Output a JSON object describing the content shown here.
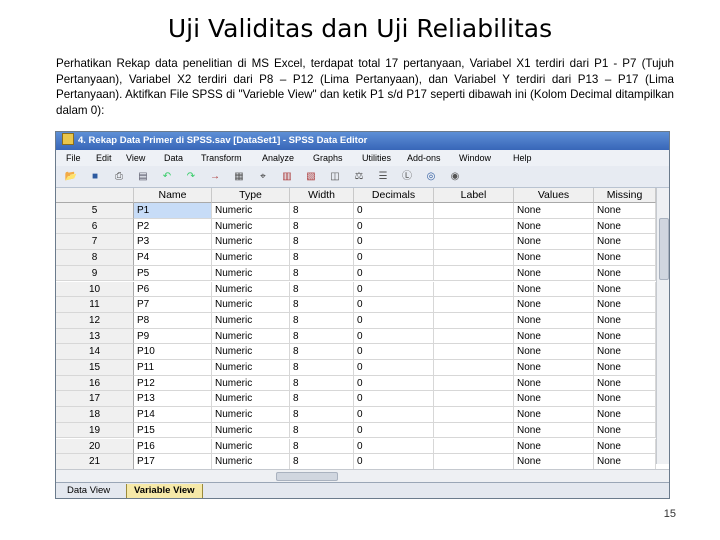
{
  "slide": {
    "title": "Uji Validitas dan Uji Reliabilitas",
    "intro": "Perhatikan Rekap data penelitian di MS Excel, terdapat total 17 pertanyaan, Variabel X1 terdiri dari P1 - P7 (Tujuh Pertanyaan), Variabel X2 terdiri dari P8 – P12 (Lima Pertanyaan), dan Variabel Y terdiri dari P13 – P17 (Lima Pertanyaan). Aktifkan File SPSS di \"Varieble View\" dan ketik P1 s/d P17 seperti dibawah ini (Kolom Decimal ditampilkan dalam 0):",
    "page_number": "15"
  },
  "window": {
    "title": "4. Rekap Data Primer di SPSS.sav [DataSet1] - SPSS Data Editor"
  },
  "menu": [
    "File",
    "Edit",
    "View",
    "Data",
    "Transform",
    "Analyze",
    "Graphs",
    "Utilities",
    "Add-ons",
    "Window",
    "Help"
  ],
  "toolbar_icons": [
    "open-icon",
    "save-icon",
    "print-icon",
    "dialog-recall-icon",
    "undo-icon",
    "redo-icon",
    "goto-case-icon",
    "variables-icon",
    "find-icon",
    "insert-cases-icon",
    "insert-variable-icon",
    "split-file-icon",
    "weight-cases-icon",
    "select-cases-icon",
    "value-labels-icon",
    "use-sets-icon",
    "show-all-icon"
  ],
  "columns": [
    "Name",
    "Type",
    "Width",
    "Decimals",
    "Label",
    "Values",
    "Missing"
  ],
  "rows": [
    {
      "n": "5",
      "name": "P1",
      "type": "Numeric",
      "width": "8",
      "decimals": "0",
      "label": "",
      "values": "None",
      "missing": "None"
    },
    {
      "n": "6",
      "name": "P2",
      "type": "Numeric",
      "width": "8",
      "decimals": "0",
      "label": "",
      "values": "None",
      "missing": "None"
    },
    {
      "n": "7",
      "name": "P3",
      "type": "Numeric",
      "width": "8",
      "decimals": "0",
      "label": "",
      "values": "None",
      "missing": "None"
    },
    {
      "n": "8",
      "name": "P4",
      "type": "Numeric",
      "width": "8",
      "decimals": "0",
      "label": "",
      "values": "None",
      "missing": "None"
    },
    {
      "n": "9",
      "name": "P5",
      "type": "Numeric",
      "width": "8",
      "decimals": "0",
      "label": "",
      "values": "None",
      "missing": "None"
    },
    {
      "n": "10",
      "name": "P6",
      "type": "Numeric",
      "width": "8",
      "decimals": "0",
      "label": "",
      "values": "None",
      "missing": "None"
    },
    {
      "n": "11",
      "name": "P7",
      "type": "Numeric",
      "width": "8",
      "decimals": "0",
      "label": "",
      "values": "None",
      "missing": "None"
    },
    {
      "n": "12",
      "name": "P8",
      "type": "Numeric",
      "width": "8",
      "decimals": "0",
      "label": "",
      "values": "None",
      "missing": "None"
    },
    {
      "n": "13",
      "name": "P9",
      "type": "Numeric",
      "width": "8",
      "decimals": "0",
      "label": "",
      "values": "None",
      "missing": "None"
    },
    {
      "n": "14",
      "name": "P10",
      "type": "Numeric",
      "width": "8",
      "decimals": "0",
      "label": "",
      "values": "None",
      "missing": "None"
    },
    {
      "n": "15",
      "name": "P11",
      "type": "Numeric",
      "width": "8",
      "decimals": "0",
      "label": "",
      "values": "None",
      "missing": "None"
    },
    {
      "n": "16",
      "name": "P12",
      "type": "Numeric",
      "width": "8",
      "decimals": "0",
      "label": "",
      "values": "None",
      "missing": "None"
    },
    {
      "n": "17",
      "name": "P13",
      "type": "Numeric",
      "width": "8",
      "decimals": "0",
      "label": "",
      "values": "None",
      "missing": "None"
    },
    {
      "n": "18",
      "name": "P14",
      "type": "Numeric",
      "width": "8",
      "decimals": "0",
      "label": "",
      "values": "None",
      "missing": "None"
    },
    {
      "n": "19",
      "name": "P15",
      "type": "Numeric",
      "width": "8",
      "decimals": "0",
      "label": "",
      "values": "None",
      "missing": "None"
    },
    {
      "n": "20",
      "name": "P16",
      "type": "Numeric",
      "width": "8",
      "decimals": "0",
      "label": "",
      "values": "None",
      "missing": "None"
    },
    {
      "n": "21",
      "name": "P17",
      "type": "Numeric",
      "width": "8",
      "decimals": "0",
      "label": "",
      "values": "None",
      "missing": "None"
    }
  ],
  "tabs": {
    "data_view": "Data View",
    "variable_view": "Variable View",
    "active": "variable_view"
  },
  "colors": {
    "titlebar": "#3866b8",
    "selected_cell": "#c7dcf7",
    "active_tab": "#f6e9a8"
  }
}
